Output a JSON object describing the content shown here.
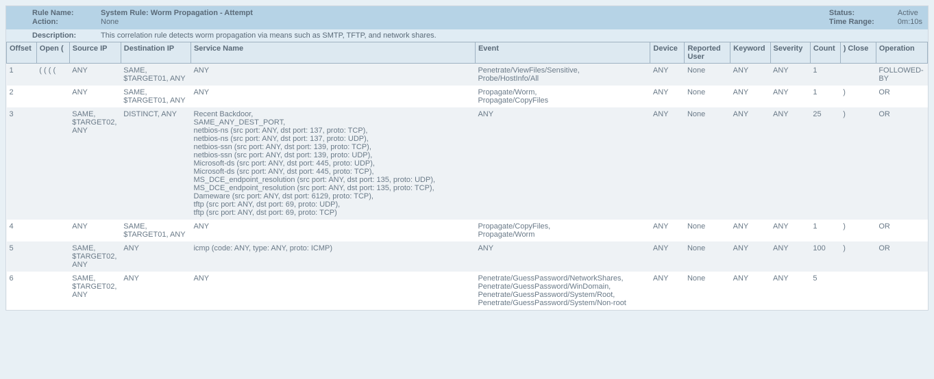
{
  "header": {
    "rule_name_label": "Rule Name:",
    "rule_name": "System Rule: Worm Propagation - Attempt",
    "action_label": "Action:",
    "action": "None",
    "description_label": "Description:",
    "description": "This correlation rule detects worm propagation via means such as SMTP, TFTP, and network shares.",
    "status_label": "Status:",
    "status": "Active",
    "time_range_label": "Time Range:",
    "time_range": "0m:10s"
  },
  "columns": {
    "offset": "Offset",
    "open": "Open (",
    "source_ip": "Source IP",
    "destination_ip": "Destination IP",
    "service_name": "Service Name",
    "event": "Event",
    "device": "Device",
    "reported_user": "Reported User",
    "keyword": "Keyword",
    "severity": "Severity",
    "count": "Count",
    "close": ") Close",
    "operation": "Operation"
  },
  "rows": [
    {
      "offset": "1",
      "open": "( ( ( (",
      "source_ip": "ANY",
      "destination_ip": "SAME, $TARGET01, ANY",
      "service_name": "ANY",
      "event": "Penetrate/ViewFiles/Sensitive, Probe/HostInfo/All",
      "device": "ANY",
      "reported_user": "None",
      "keyword": "ANY",
      "severity": "ANY",
      "count": "1",
      "close": "",
      "operation": "FOLLOWED-BY"
    },
    {
      "offset": "2",
      "open": "",
      "source_ip": "ANY",
      "destination_ip": "SAME, $TARGET01, ANY",
      "service_name": "ANY",
      "event": "Propagate/Worm, Propagate/CopyFiles",
      "device": "ANY",
      "reported_user": "None",
      "keyword": "ANY",
      "severity": "ANY",
      "count": "1",
      "close": ")",
      "operation": "OR"
    },
    {
      "offset": "3",
      "open": "",
      "source_ip": "SAME, $TARGET02, ANY",
      "destination_ip": "DISTINCT, ANY",
      "service_name": "Recent Backdoor,\nSAME_ANY_DEST_PORT,\nnetbios-ns (src port: ANY, dst port: 137, proto: TCP),\nnetbios-ns (src port: ANY, dst port: 137, proto: UDP),\nnetbios-ssn (src port: ANY, dst port: 139, proto: TCP),\nnetbios-ssn (src port: ANY, dst port: 139, proto: UDP),\nMicrosoft-ds (src port: ANY, dst port: 445, proto: UDP),\nMicrosoft-ds (src port: ANY, dst port: 445, proto: TCP),\nMS_DCE_endpoint_resolution (src port: ANY, dst port: 135, proto: UDP),\nMS_DCE_endpoint_resolution (src port: ANY, dst port: 135, proto: TCP),\nDameware (src port: ANY, dst port: 6129, proto: TCP),\ntftp (src port: ANY, dst port: 69, proto: UDP),\ntftp (src port: ANY, dst port: 69, proto: TCP)",
      "event": "ANY",
      "device": "ANY",
      "reported_user": "None",
      "keyword": "ANY",
      "severity": "ANY",
      "count": "25",
      "close": ")",
      "operation": "OR"
    },
    {
      "offset": "4",
      "open": "",
      "source_ip": "ANY",
      "destination_ip": "SAME, $TARGET01, ANY",
      "service_name": "ANY",
      "event": "Propagate/CopyFiles, Propagate/Worm",
      "device": "ANY",
      "reported_user": "None",
      "keyword": "ANY",
      "severity": "ANY",
      "count": "1",
      "close": ")",
      "operation": "OR"
    },
    {
      "offset": "5",
      "open": "",
      "source_ip": "SAME, $TARGET02, ANY",
      "destination_ip": "ANY",
      "service_name": "icmp (code: ANY, type: ANY, proto: ICMP)",
      "event": "ANY",
      "device": "ANY",
      "reported_user": "None",
      "keyword": "ANY",
      "severity": "ANY",
      "count": "100",
      "close": ")",
      "operation": "OR"
    },
    {
      "offset": "6",
      "open": "",
      "source_ip": "SAME, $TARGET02, ANY",
      "destination_ip": "ANY",
      "service_name": "ANY",
      "event": "Penetrate/GuessPassword/NetworkShares, Penetrate/GuessPassword/WinDomain, Penetrate/GuessPassword/System/Root, Penetrate/GuessPassword/System/Non-root",
      "device": "ANY",
      "reported_user": "None",
      "keyword": "ANY",
      "severity": "ANY",
      "count": "5",
      "close": "",
      "operation": ""
    }
  ]
}
